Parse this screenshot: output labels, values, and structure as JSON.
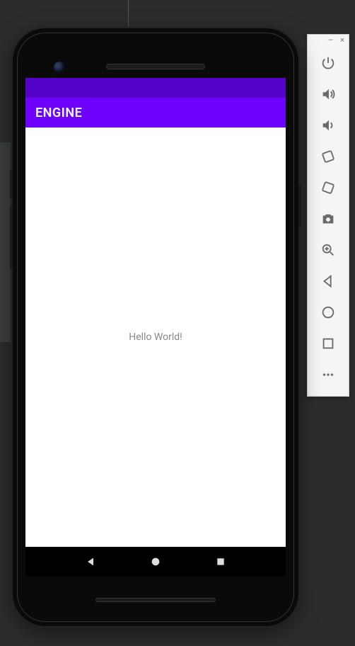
{
  "app": {
    "title": "ENGINE",
    "body_text": "Hello World!"
  },
  "colors": {
    "status_bar": "#5502c9",
    "app_bar": "#6d02ff",
    "content_bg": "#ffffff"
  },
  "nav": {
    "back": "back",
    "home": "home",
    "recent": "recent"
  },
  "emulator_toolbar": {
    "minimize": "–",
    "close": "×",
    "items": [
      {
        "name": "power"
      },
      {
        "name": "volume-up"
      },
      {
        "name": "volume-down"
      },
      {
        "name": "rotate-left"
      },
      {
        "name": "rotate-right"
      },
      {
        "name": "camera"
      },
      {
        "name": "zoom"
      },
      {
        "name": "back"
      },
      {
        "name": "home"
      },
      {
        "name": "overview"
      },
      {
        "name": "more"
      }
    ]
  }
}
